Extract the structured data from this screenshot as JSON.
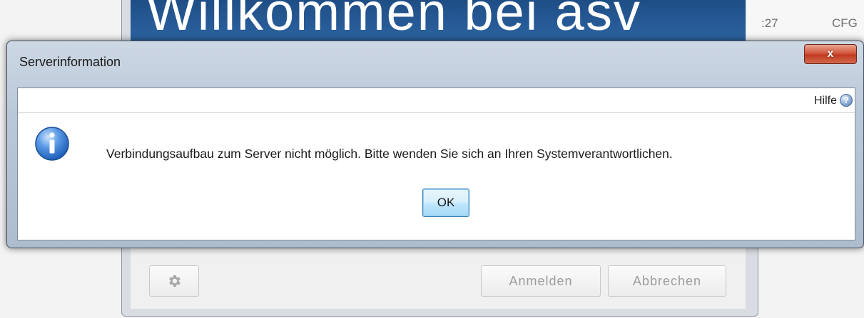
{
  "background": {
    "banner_text": "Willkommen bei asv",
    "time_fragment": ":27",
    "cfg_label": "CFG",
    "gear_icon": "gear-icon",
    "buttons": {
      "login": "Anmelden",
      "cancel": "Abbrechen"
    }
  },
  "dialog": {
    "title": "Serverinformation",
    "close_label": "x",
    "help_label": "Hilfe",
    "help_icon": "question-icon",
    "info_icon": "info-icon",
    "message": "Verbindungsaufbau zum Server nicht möglich. Bitte wenden Sie sich an Ihren Systemverantwortlichen.",
    "ok_label": "OK"
  },
  "colors": {
    "banner": "#1f4e86",
    "close_button": "#c7432a",
    "ok_button": "#bee6fd",
    "info_icon": "#3a7bd5"
  }
}
